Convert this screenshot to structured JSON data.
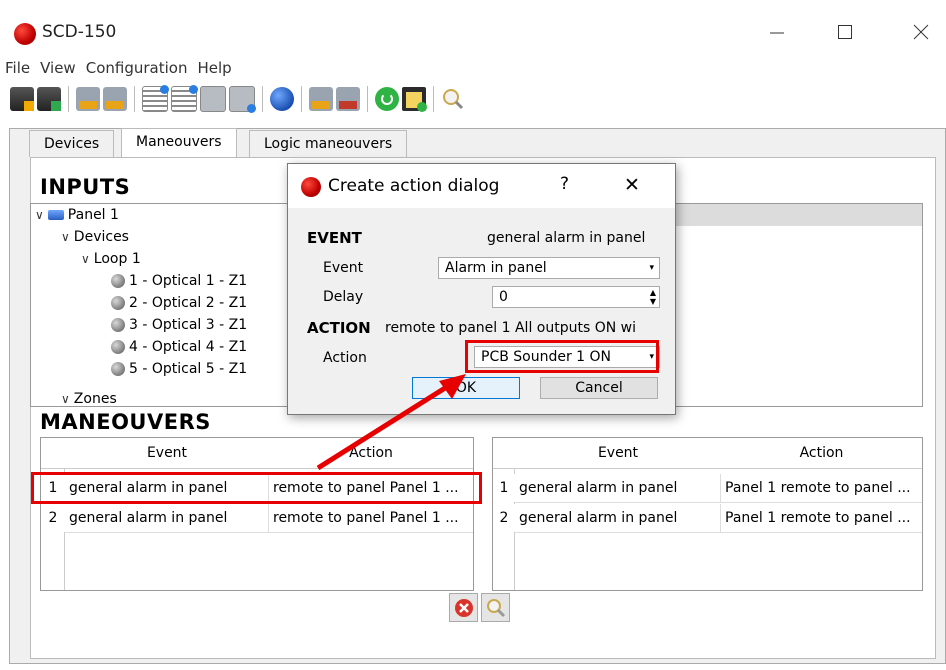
{
  "window": {
    "title": "SCD-150"
  },
  "menu": [
    "File",
    "View",
    "Configuration",
    "Help"
  ],
  "toolbar": {
    "icons": [
      "save-icon",
      "save-green-icon",
      "csv-export-icon",
      "csv-import-icon",
      "list-add-icon",
      "list-add-blue-icon",
      "document-icon",
      "document-add-icon",
      "globe-icon",
      "csv-icon",
      "txt-icon",
      "refresh-icon",
      "clipboard-icon",
      "search-icon"
    ]
  },
  "tabs": [
    "Devices",
    "Maneouvers",
    "Logic maneouvers"
  ],
  "inputs": {
    "heading": "INPUTS",
    "tree": [
      {
        "label": "Panel 1"
      },
      {
        "label": "Devices"
      },
      {
        "label": "Loop 1"
      },
      {
        "label": "1 - Optical 1 - Z1"
      },
      {
        "label": "2 - Optical 2 - Z1"
      },
      {
        "label": "3 - Optical 3 - Z1"
      },
      {
        "label": "4 - Optical 4 - Z1"
      },
      {
        "label": "5 - Optical 5 - Z1"
      },
      {
        "label": "Zones"
      }
    ]
  },
  "maneouvers": {
    "heading": "MANEOUVERS",
    "left_table": {
      "columns": [
        "Event",
        "Action"
      ],
      "rows": [
        {
          "num": "1",
          "event": "general alarm in panel",
          "action": "remote to panel Panel 1 ..."
        },
        {
          "num": "2",
          "event": "general alarm in panel",
          "action": "remote to panel Panel 1 ..."
        }
      ]
    },
    "right_table": {
      "columns": [
        "Event",
        "Action"
      ],
      "rows": [
        {
          "num": "1",
          "event": "general alarm in panel",
          "action": "Panel 1  remote to panel ..."
        },
        {
          "num": "2",
          "event": "general alarm in panel",
          "action": "Panel 1  remote to panel ..."
        }
      ]
    }
  },
  "dialog": {
    "title": "Create action dialog",
    "help": "?",
    "close": "✕",
    "event_heading": "EVENT",
    "event_summary": "general alarm in panel",
    "event_label": "Event",
    "event_value": "Alarm in panel",
    "delay_label": "Delay",
    "delay_value": "0",
    "action_heading": "ACTION",
    "action_summary": "remote to panel 1  All outputs ON wi",
    "action_label": "Action",
    "action_value": "PCB Sounder 1 ON",
    "ok_label": "OK",
    "cancel_label": "Cancel"
  },
  "colors": {
    "highlight_red": "#e60000",
    "brand_red": "#c00000"
  }
}
